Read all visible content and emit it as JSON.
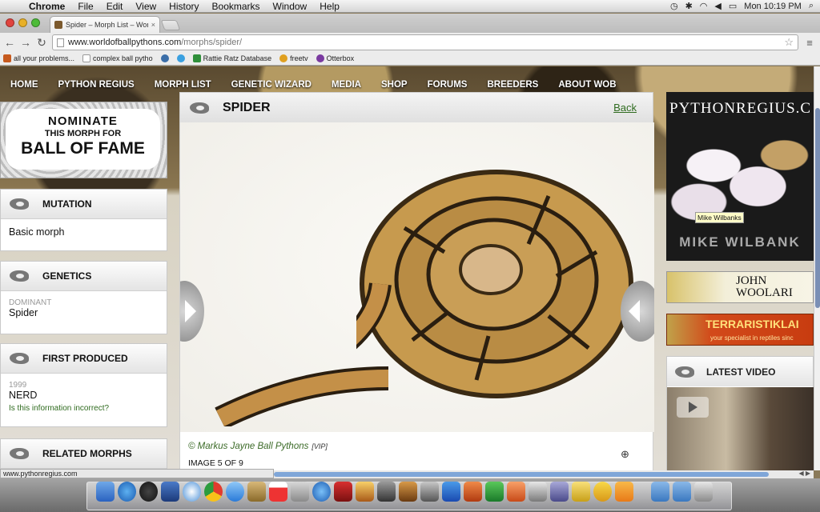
{
  "menubar": {
    "app": "Chrome",
    "items": [
      "File",
      "Edit",
      "View",
      "History",
      "Bookmarks",
      "Window",
      "Help"
    ],
    "clock": "Mon 10:19 PM"
  },
  "tab": {
    "title": "Spider – Morph List – Worl",
    "close": "×"
  },
  "toolbar": {
    "url_host": "www.worldofballpythons.com",
    "url_path": "/morphs/spider/"
  },
  "bookmarks": [
    {
      "label": "all your problems...",
      "color": "#c65a1e"
    },
    {
      "label": "complex ball pytho",
      "color": "#d8d8d8"
    },
    {
      "label": "",
      "color": "#3b6ea8"
    },
    {
      "label": "",
      "color": "#3aa0e0"
    },
    {
      "label": "Rattie Ratz Database",
      "color": "#2f8f3a"
    },
    {
      "label": "freetv",
      "color": "#e0a020"
    },
    {
      "label": "Otterbox",
      "color": "#7a3aa0"
    }
  ],
  "site_nav": [
    "HOME",
    "PYTHON REGIUS",
    "MORPH LIST",
    "GENETIC WIZARD",
    "MEDIA",
    "SHOP",
    "FORUMS",
    "BREEDERS",
    "ABOUT WOB"
  ],
  "nominate": {
    "line1": "NOMINATE",
    "line2": "THIS MORPH FOR",
    "line3": "BALL OF FAME"
  },
  "mutation": {
    "title": "MUTATION",
    "value": "Basic morph"
  },
  "genetics": {
    "title": "GENETICS",
    "label": "DOMINANT",
    "value": "Spider"
  },
  "first_produced": {
    "title": "FIRST PRODUCED",
    "year": "1999",
    "value": "NERD",
    "link": "Is this information incorrect?"
  },
  "related": {
    "title": "RELATED MORPHS"
  },
  "main": {
    "title": "SPIDER",
    "back": "Back",
    "credit": "© Markus Jayne Ball Pythons",
    "vip": "[VIP]",
    "image_count": "IMAGE 5 OF 9"
  },
  "ads": {
    "pythonregius": "PYTHONREGIUS.C",
    "tooltip": "Mike Wilbanks",
    "mike": "MIKE WILBANK",
    "john_line1": "JOHN",
    "john_line2": "WOOLARI",
    "terra": "TERRARISTIKLAI",
    "terra_sub": "your specialist in reptiles sinc"
  },
  "video": {
    "title": "LATEST VIDEO"
  },
  "statusbar": {
    "url": "www.pythonregius.com"
  },
  "colors": {
    "nav_text": "#ffffff",
    "link_green": "#2f6b1f",
    "scroll_thumb": "#7a8fb5"
  }
}
